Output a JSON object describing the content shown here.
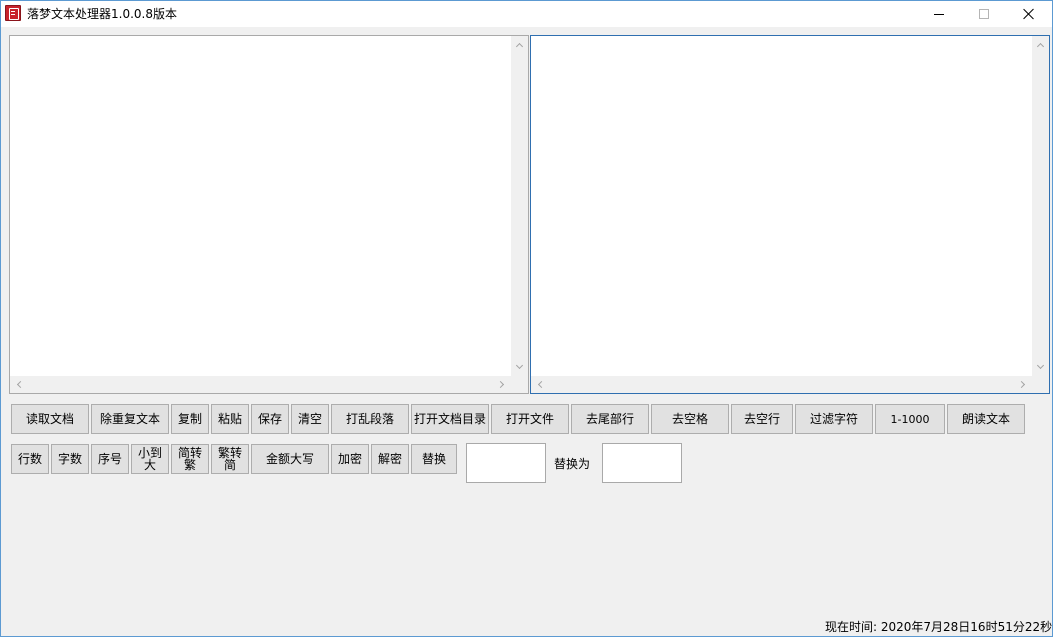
{
  "window": {
    "title": "落梦文本处理器1.0.0.8版本"
  },
  "toolbar_row1": [
    "读取文档",
    "除重复文本",
    "复制",
    "粘贴",
    "保存",
    "清空",
    "打乱段落",
    "打开文档目录",
    "打开文件",
    "去尾部行",
    "去空格",
    "去空行",
    "过滤字符",
    "1-1000",
    "朗读文本"
  ],
  "toolbar_row2": [
    "行数",
    "字数",
    "序号",
    "小到大",
    "简转繁",
    "繁转简",
    "金额大写",
    "加密",
    "解密",
    "替换"
  ],
  "replace": {
    "find_value": "",
    "replace_label": "替换为",
    "replace_value": ""
  },
  "status": {
    "current_time": "现在时间: 2020年7月28日16时51分22秒"
  },
  "colors": {
    "window_border": "#5c9ad2",
    "active_textbox_border": "#2f6fb0",
    "button_bg": "#e1e1e1",
    "app_icon": "#c8232c"
  }
}
